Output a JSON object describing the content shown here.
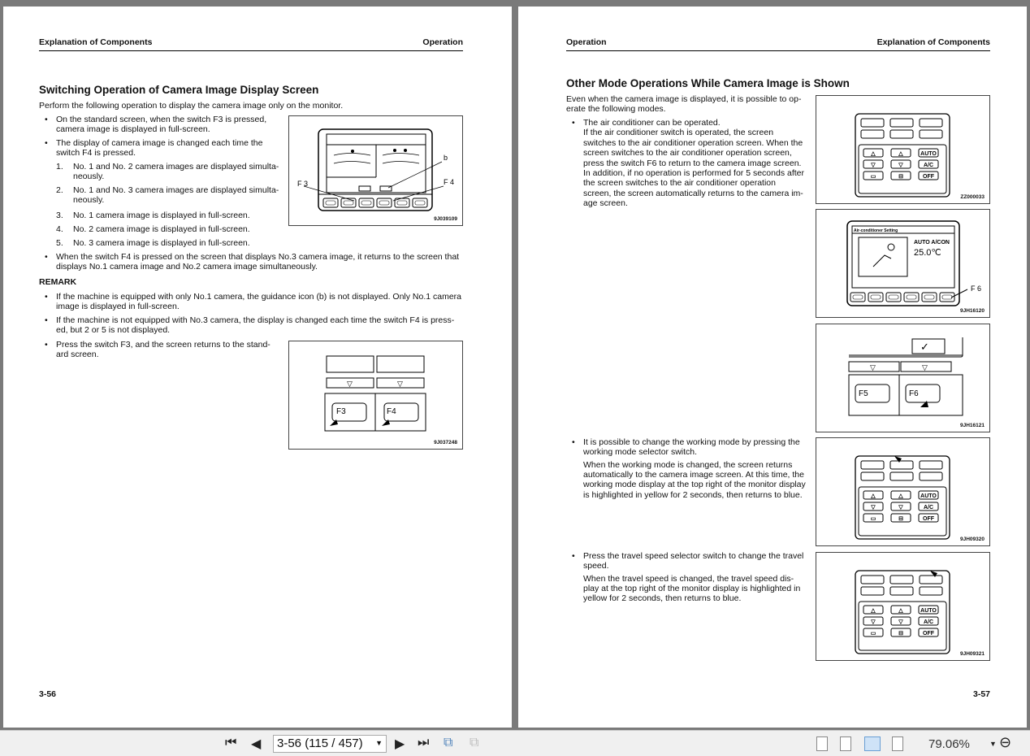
{
  "left_page": {
    "header_left": "Explanation of Components",
    "header_right": "Operation",
    "title": "Switching Operation of Camera Image Display Screen",
    "intro": "Perform the following operation to display the camera image only on the monitor.",
    "bullet1": [
      "On the standard screen, when the switch F3 is pressed,",
      "camera image is displayed in full-screen."
    ],
    "bullet2": [
      "The display of camera image is changed each time the",
      "switch F4 is pressed."
    ],
    "numbered": [
      {
        "n": "1.",
        "lines": [
          "No. 1 and No. 2 camera images are displayed simulta-",
          "neously."
        ]
      },
      {
        "n": "2.",
        "lines": [
          "No. 1 and No. 3 camera images are displayed simulta-",
          "neously."
        ]
      },
      {
        "n": "3.",
        "lines": [
          "No. 1 camera image is displayed in full-screen."
        ]
      },
      {
        "n": "4.",
        "lines": [
          "No. 2 camera image is displayed in full-screen."
        ]
      },
      {
        "n": "5.",
        "lines": [
          "No. 3 camera image is displayed in full-screen."
        ]
      }
    ],
    "bullet3": [
      "When the switch F4 is pressed on the screen that displays No.3 camera image, it returns to the screen that",
      "displays No.1 camera image and No.2 camera image simultaneously."
    ],
    "remark": "REMARK",
    "remark_items": [
      [
        "If the machine is equipped with only No.1 camera, the guidance icon (b) is not displayed. Only No.1 camera",
        "image is displayed in full-screen."
      ],
      [
        "If the machine is not equipped with No.3 camera, the display is changed each time the switch F4 is press-",
        "ed, but 2 or 5 is not displayed."
      ],
      [
        "Press the switch F3, and the screen returns to the stand-",
        "ard screen."
      ]
    ],
    "fig1": {
      "caption": "9J039109",
      "label_f3": "F 3",
      "label_f4": "F 4",
      "label_b": "b"
    },
    "fig2": {
      "caption": "9J037248",
      "key1": "F3",
      "key2": "F4"
    },
    "page_number": "3-56"
  },
  "right_page": {
    "header_left": "Operation",
    "header_right": "Explanation of Components",
    "title": "Other Mode Operations While Camera Image is Shown",
    "intro": [
      "Even when the camera image is displayed, it is possible to op-",
      "erate the following modes."
    ],
    "ac_bullet": [
      "The air conditioner can be operated.",
      "If the air conditioner switch is operated, the screen",
      "switches to the air conditioner operation screen. When the",
      "screen switches to the air conditioner operation screen,",
      "press the switch F6 to return to the camera image screen.",
      "In addition, if no operation is performed for 5 seconds after",
      "the screen switches to the air conditioner operation",
      "screen, the screen automatically returns to the camera im-",
      "age screen."
    ],
    "wm_bullet": [
      "It is possible to change the working mode by pressing the",
      "working mode selector switch.",
      "When the working mode is changed, the screen returns",
      "automatically to the camera image screen. At this time, the",
      "working mode display at the top right of the monitor display",
      "is highlighted in yellow for 2 seconds, then returns to blue."
    ],
    "ts_bullet": [
      "Press the travel speed selector switch to change the travel",
      "speed.",
      "When the travel speed is changed, the travel speed dis-",
      "play at the top right of the monitor display is highlighted in",
      "yellow for 2 seconds, then returns to blue."
    ],
    "fig_keypad1": {
      "caption": "ZZ000033"
    },
    "fig_ac": {
      "caption": "9JH16120",
      "label": "F 6",
      "screen_title": "Air-conditioner Setting",
      "mode": "AUTO  A/CON",
      "temp": "25.0℃"
    },
    "fig_f56": {
      "caption": "9JH16121",
      "key1": "F5",
      "key2": "F6"
    },
    "fig_keypad2": {
      "caption": "9JH09320"
    },
    "fig_keypad3": {
      "caption": "9JH09321"
    },
    "keypad_labels": {
      "auto": "AUTO",
      "ac": "A/C",
      "off": "OFF"
    },
    "page_number": "3-57"
  },
  "toolbar": {
    "page_value": "3-56 (115 / 457)",
    "zoom": "79.06%"
  }
}
